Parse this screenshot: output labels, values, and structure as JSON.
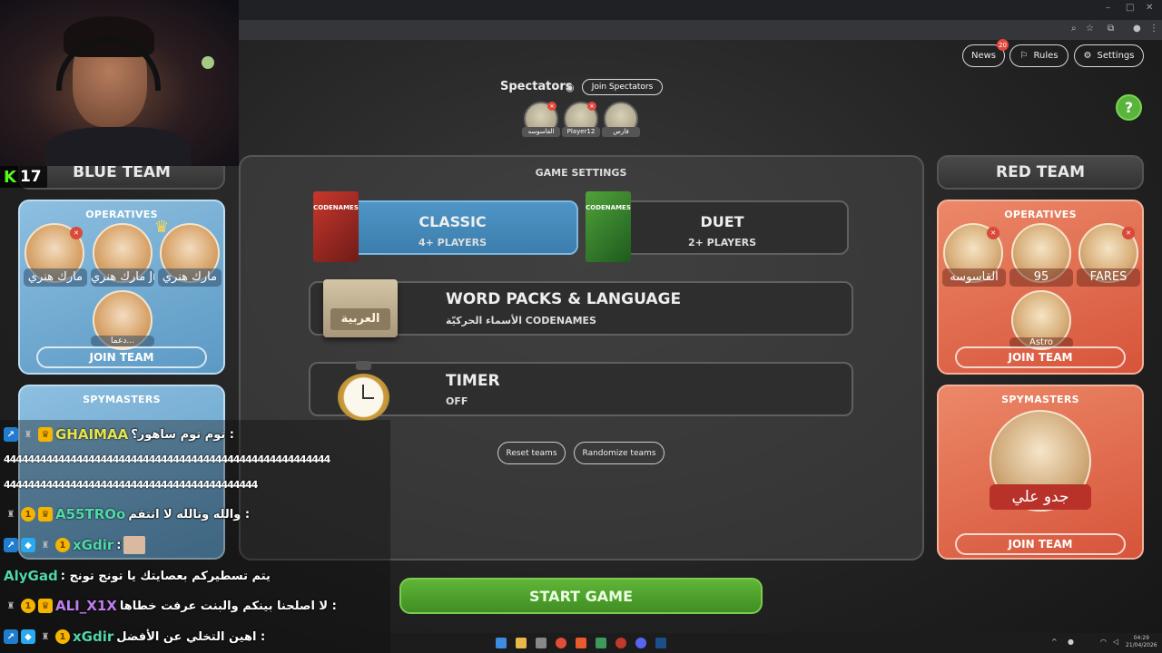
{
  "header": {
    "news_label": "News",
    "news_count": "20",
    "rules_label": "Rules",
    "settings_label": "Settings",
    "help_symbol": "?"
  },
  "spectators": {
    "title": "Spectators",
    "join_label": "Join Spectators",
    "players": [
      {
        "name": "القاسوسه"
      },
      {
        "name": "Player12"
      },
      {
        "name": "فارس"
      }
    ]
  },
  "blue_team": {
    "title": "BLUE TEAM",
    "operatives_title": "OPERATIVES",
    "operatives": [
      {
        "name": "مارك هنري"
      },
      {
        "name": "مارك هنري Jr."
      },
      {
        "name": "مارك هنري"
      },
      {
        "name": "دعما..."
      }
    ],
    "join_label": "JOIN TEAM",
    "spymasters_title": "SPYMASTERS"
  },
  "red_team": {
    "title": "RED TEAM",
    "operatives_title": "OPERATIVES",
    "operatives": [
      {
        "name": "القاسوسه"
      },
      {
        "name": "95"
      },
      {
        "name": "FARES"
      },
      {
        "name": "Astro"
      }
    ],
    "join_label": "JOIN TEAM",
    "spymasters_title": "SPYMASTERS",
    "spymaster_name": "جدو علي",
    "spymaster_join_label": "JOIN TEAM"
  },
  "game_settings": {
    "title": "GAME SETTINGS",
    "classic": {
      "title": "CLASSIC",
      "sub": "4+ PLAYERS",
      "box_label": "CODENAMES"
    },
    "duet": {
      "title": "DUET",
      "sub": "2+ PLAYERS",
      "box_label": "CODENAMES"
    },
    "word_packs": {
      "title": "WORD PACKS & LANGUAGE",
      "sub": "الأسماء الحركيّة CODENAMES",
      "pack_label": "العربية"
    },
    "timer": {
      "title": "TIMER",
      "sub": "OFF"
    },
    "reset_label": "Reset teams",
    "randomize_label": "Randomize teams",
    "start_label": "START GAME"
  },
  "stream": {
    "viewer_count": "17",
    "chat": [
      {
        "user": "GHAIMAA",
        "user_color": "#e7e34a",
        "msg": "توم توم ساهور؟ :"
      },
      {
        "user": "A55TROo",
        "user_color": "#4fd8a9",
        "msg": "والله وتالله لا انتقم :"
      },
      {
        "user": "xGdir",
        "user_color": "#4fd8a9",
        "msg": ":"
      },
      {
        "user": "AlyGad",
        "user_color": "#4fd8a9",
        "msg": ": يتم تسطيركم بعصايتك يا تونج تونج"
      },
      {
        "user": "ALI_X1X",
        "user_color": "#c07ef0",
        "msg": "لا اصلحنا بينكم والبنت عرفت خطاها :"
      },
      {
        "user": "xGdir",
        "user_color": "#4fd8a9",
        "msg": "اهين التخلي عن الأفضل :"
      }
    ],
    "spam_line_1": "444444444444444444444444444444444444444444444444444444",
    "spam_line_2": "444444444444444444444444444444444444444444"
  },
  "taskbar": {
    "time": "04:29",
    "date": "21/04/2026"
  }
}
